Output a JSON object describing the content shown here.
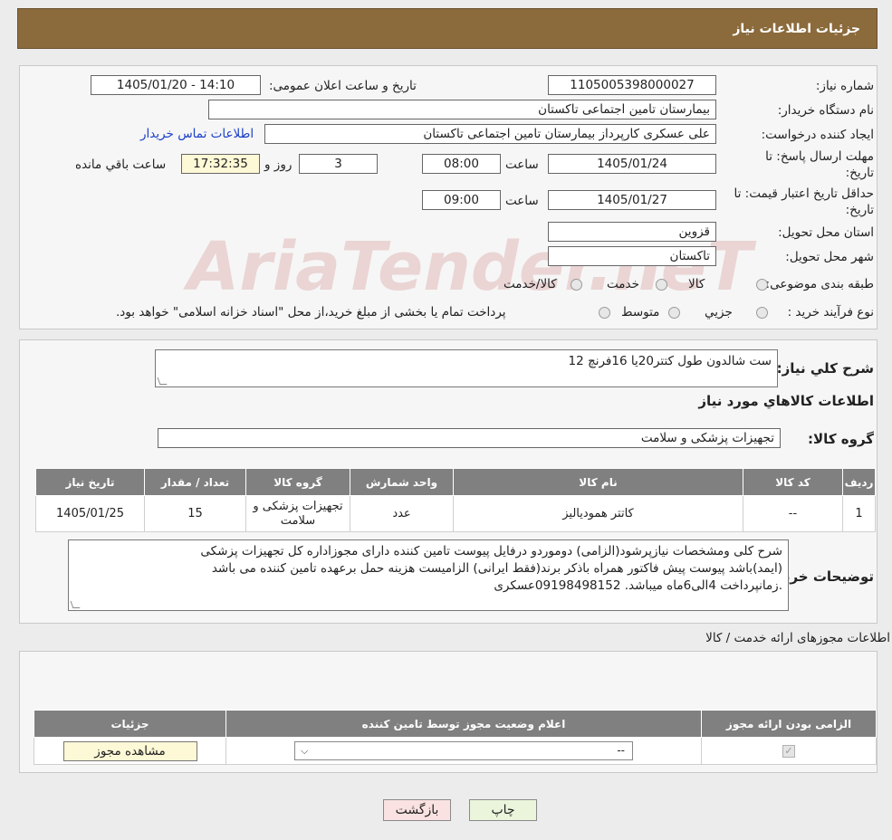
{
  "header": {
    "title": "جزئیات اطلاعات نیاز"
  },
  "watermark": {
    "text": "AriaTender.neT"
  },
  "form": {
    "need_number_label": "شماره نیاز:",
    "need_number": "1105005398000027",
    "announce_label": "تاریخ و ساعت اعلان عمومی:",
    "announce_value": "1405/01/20 - 14:10",
    "buyer_org_label": "نام دستگاه خریدار:",
    "buyer_org": "بیمارستان تامین اجتماعی تاکستان",
    "creator_label": "ایجاد کننده درخواست:",
    "creator": "علی عسکری کارپرداز بیمارستان تامین اجتماعی تاکستان",
    "contact_link": "اطلاعات تماس خریدار",
    "deadline_label_1": "مهلت ارسال پاسخ: تا",
    "deadline_label_2": "تاریخ:",
    "deadline_date": "1405/01/24",
    "time_label": "ساعت",
    "deadline_time": "08:00",
    "days_value": "3",
    "days_label": "روز و",
    "remaining_time": "17:32:35",
    "remaining_label": "ساعت باقي مانده",
    "validity_label_1": "حداقل تاریخ اعتبار قیمت: تا",
    "validity_label_2": "تاریخ:",
    "validity_date": "1405/01/27",
    "validity_time": "09:00",
    "province_label": "استان محل تحویل:",
    "province": "قزوین",
    "city_label": "شهر محل تحویل:",
    "city": "تاکستان",
    "category_label": "طبقه بندی موضوعی:",
    "category_options": [
      "کالا",
      "خدمت",
      "کالا/خدمت"
    ],
    "process_label": "نوع فرآیند خرید :",
    "process_options": [
      "جزیي",
      "متوسط"
    ],
    "process_note": "پرداخت تمام یا بخشی از مبلغ خرید،از محل \"اسناد خزانه اسلامی\" خواهد بود."
  },
  "summary": {
    "general_desc_label": "شرح کلي نیاز:",
    "general_desc": "ست شالدون طول کتتر20یا 16فرنچ 12",
    "goods_info_title": "اطلاعات کالاهاي مورد نیاز",
    "goods_group_label": "گروه کالا:",
    "goods_group": "تجهیزات پزشکی و سلامت",
    "table": {
      "headers": [
        "ردیف",
        "کد کالا",
        "نام کالا",
        "واحد شمارش",
        "گروه کالا",
        "تعداد / مقدار",
        "تاریخ نیاز"
      ],
      "rows": [
        [
          "1",
          "--",
          "کاتتر همودیالیز",
          "عدد",
          "تجهیزات پزشکی و سلامت",
          "15",
          "1405/01/25"
        ]
      ]
    },
    "buyer_notes_label": "توضیحات خریدار:",
    "buyer_notes_1": "شرح کلی ومشخصات نیازپرشود(الزامی) دوموردو درفایل پیوست تامین کننده دارای مجوزاداره کل تجهیزات پزشکی",
    "buyer_notes_2": "(ایمد)باشد پیوست پیش فاکتور همراه باذکر برند(فقط ایرانی) الزامیست هزینه حمل برعهده تامین کننده می باشد",
    "buyer_notes_3": ".زمانپرداخت 4الی6ماه میباشد. 09198498152عسکری"
  },
  "permits": {
    "title": "اطلاعات مجوزهای ارائه خدمت / کالا",
    "headers": [
      "الزامی بودن ارائه مجوز",
      "اعلام وضعیت مجوز توسط تامین کننده",
      "جزئیات"
    ],
    "select_value": "--",
    "view_button": "مشاهده مجوز"
  },
  "buttons": {
    "print": "چاپ",
    "back": "بازگشت"
  }
}
